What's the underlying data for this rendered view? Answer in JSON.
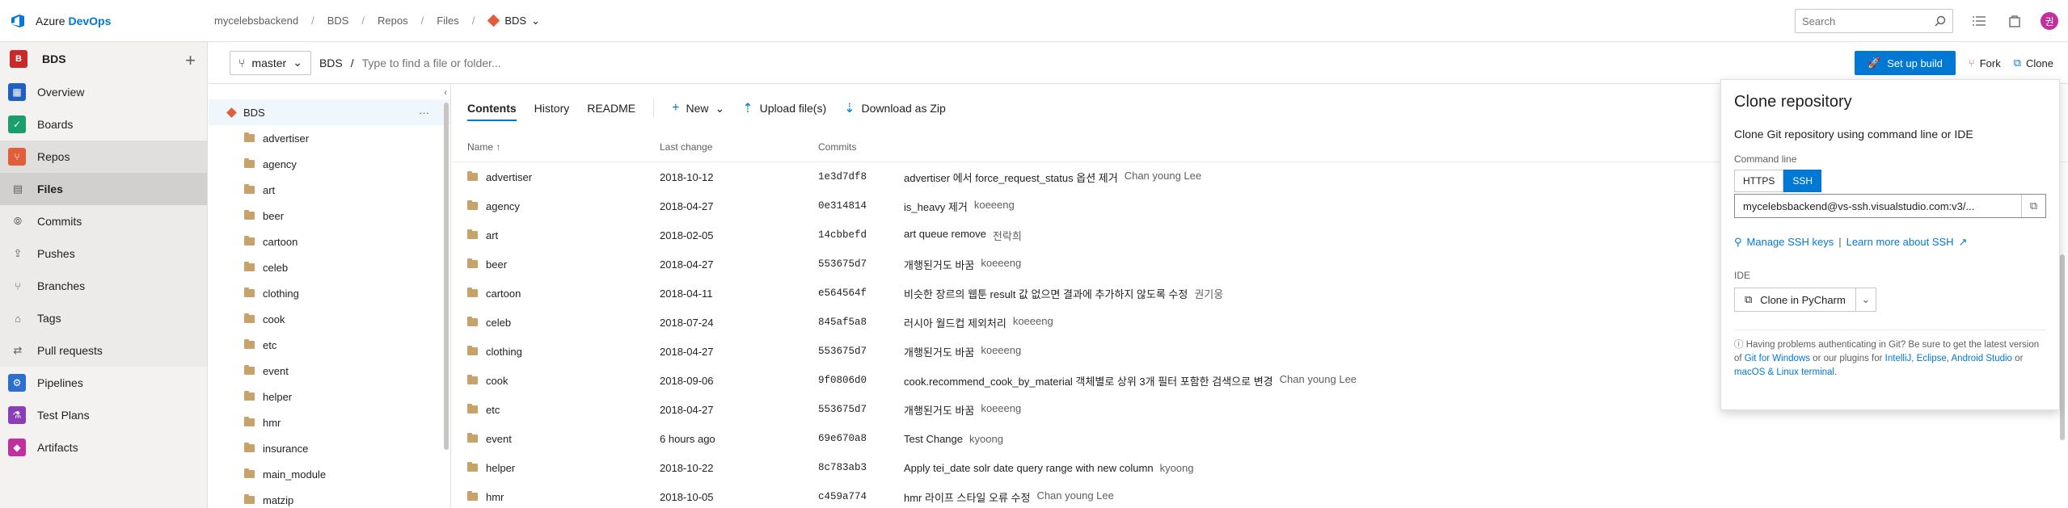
{
  "app": {
    "name_part1": "Azure ",
    "name_part2": "DevOps"
  },
  "breadcrumb": [
    "mycelebsbackend",
    "BDS",
    "Repos",
    "Files"
  ],
  "breadcrumb_current": "BDS",
  "search": {
    "placeholder": "Search"
  },
  "user": {
    "initial": "권"
  },
  "project": {
    "badge": "B",
    "name": "BDS"
  },
  "nav": {
    "overview": "Overview",
    "boards": "Boards",
    "repos": "Repos",
    "repos_sub": [
      "Files",
      "Commits",
      "Pushes",
      "Branches",
      "Tags",
      "Pull requests"
    ],
    "pipelines": "Pipelines",
    "test_plans": "Test Plans",
    "artifacts": "Artifacts"
  },
  "toolbar": {
    "branch": "master",
    "path_root": "BDS",
    "path_sep": "/",
    "path_placeholder": "Type to find a file or folder...",
    "setup_build": "Set up build",
    "fork": "Fork",
    "clone": "Clone"
  },
  "tree": {
    "root": "BDS",
    "items": [
      "advertiser",
      "agency",
      "art",
      "beer",
      "cartoon",
      "celeb",
      "clothing",
      "cook",
      "etc",
      "event",
      "helper",
      "hmr",
      "insurance",
      "main_module",
      "matzip"
    ]
  },
  "content_tabs": {
    "contents": "Contents",
    "history": "History",
    "readme": "README",
    "new": "New",
    "upload": "Upload file(s)",
    "download": "Download as Zip"
  },
  "columns": {
    "name": "Name ↑",
    "last_change": "Last change",
    "commits": "Commits"
  },
  "files": [
    {
      "name": "advertiser",
      "date": "2018-10-12",
      "commit": "1e3d7df8",
      "message": "advertiser 에서 force_request_status 옵션 제거",
      "author": "Chan young Lee"
    },
    {
      "name": "agency",
      "date": "2018-04-27",
      "commit": "0e314814",
      "message": "is_heavy 제거",
      "author": "koeeeng"
    },
    {
      "name": "art",
      "date": "2018-02-05",
      "commit": "14cbbefd",
      "message": "art queue remove",
      "author": "전락희"
    },
    {
      "name": "beer",
      "date": "2018-04-27",
      "commit": "553675d7",
      "message": "개행된거도 바꿈",
      "author": "koeeeng"
    },
    {
      "name": "cartoon",
      "date": "2018-04-11",
      "commit": "e564564f",
      "message": "비슷한 장르의 웹툰 result 값 없으면 결과에 추가하지 않도록 수정",
      "author": "권기웅"
    },
    {
      "name": "celeb",
      "date": "2018-07-24",
      "commit": "845af5a8",
      "message": "러시아 월드컵 제외처리",
      "author": "koeeeng"
    },
    {
      "name": "clothing",
      "date": "2018-04-27",
      "commit": "553675d7",
      "message": "개행된거도 바꿈",
      "author": "koeeeng"
    },
    {
      "name": "cook",
      "date": "2018-09-06",
      "commit": "9f0806d0",
      "message": "cook.recommend_cook_by_material 객체별로 상위 3개 필터 포함한 검색으로 변경",
      "author": "Chan young Lee"
    },
    {
      "name": "etc",
      "date": "2018-04-27",
      "commit": "553675d7",
      "message": "개행된거도 바꿈",
      "author": "koeeeng"
    },
    {
      "name": "event",
      "date": "6 hours ago",
      "commit": "69e670a8",
      "message": "Test Change",
      "author": "kyoong"
    },
    {
      "name": "helper",
      "date": "2018-10-22",
      "commit": "8c783ab3",
      "message": "Apply tei_date solr date query range with new column",
      "author": "kyoong"
    },
    {
      "name": "hmr",
      "date": "2018-10-05",
      "commit": "c459a774",
      "message": "hmr 라이프 스타일 오류 수정",
      "author": "Chan young Lee"
    }
  ],
  "clone_panel": {
    "title": "Clone repository",
    "subtitle": "Clone Git repository using command line or IDE",
    "command_line_label": "Command line",
    "https": "HTTPS",
    "ssh": "SSH",
    "url": "mycelebsbackend@vs-ssh.visualstudio.com:v3/...",
    "manage_ssh": "Manage SSH keys",
    "pipe": "|",
    "learn_ssh": "Learn more about SSH",
    "ide_label": "IDE",
    "clone_in": "Clone in PyCharm",
    "help_prefix": "Having problems authenticating in Git? Be sure to get the latest version of",
    "git_windows": "Git for Windows",
    "help_mid": "or our plugins for",
    "intellij": "IntelliJ",
    "eclipse": "Eclipse",
    "android_studio": "Android Studio",
    "help_or": "or",
    "macos_linux": "macOS & Linux terminal"
  },
  "colors": {
    "accent": "#0078d4",
    "repos": "#e05f3a",
    "project": "#c82a2a",
    "avatar": "#c2309f"
  }
}
